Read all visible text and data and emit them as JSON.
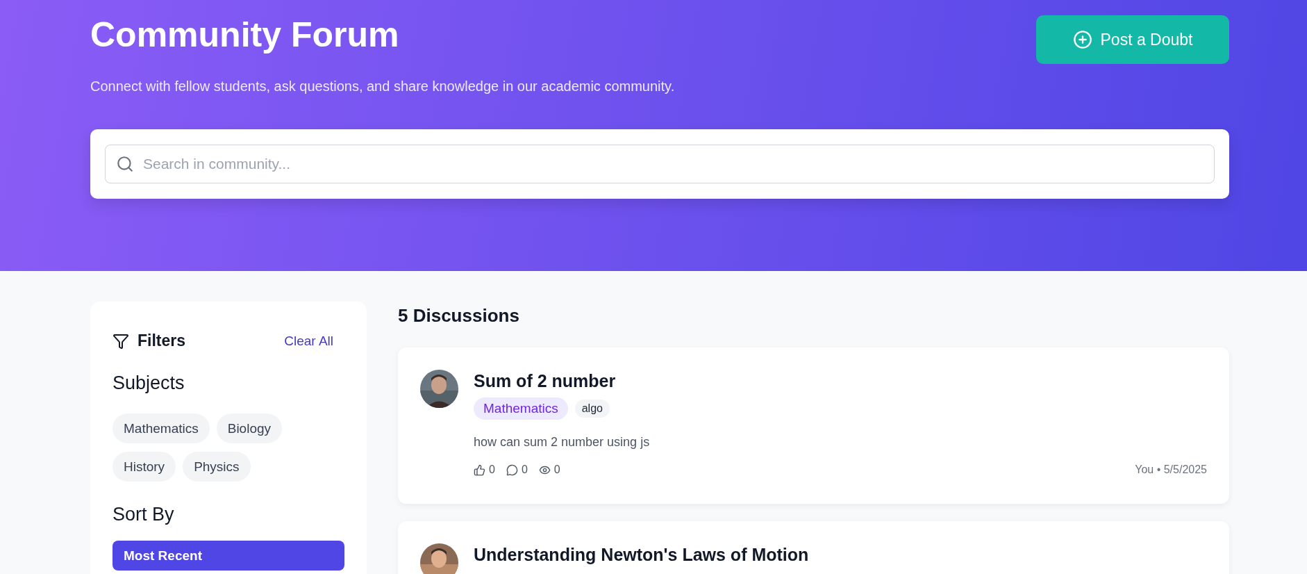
{
  "header": {
    "title": "Community Forum",
    "subtitle": "Connect with fellow students, ask questions, and share knowledge in our academic community.",
    "post_button": "Post a Doubt",
    "search": {
      "placeholder": "Search in community..."
    }
  },
  "filters": {
    "title": "Filters",
    "clear": "Clear All",
    "subjects_title": "Subjects",
    "subjects": [
      {
        "label": "Mathematics",
        "selected": false
      },
      {
        "label": "Biology",
        "selected": false
      },
      {
        "label": "History",
        "selected": false
      },
      {
        "label": "Physics",
        "selected": false
      }
    ],
    "sort_title": "Sort By",
    "sort_options": [
      {
        "label": "Most Recent",
        "selected": true
      }
    ]
  },
  "discussions": {
    "count": "5 Discussions",
    "posts": [
      {
        "title": "Sum of 2 number",
        "tags": [
          {
            "label": "Mathematics",
            "kind": "subject"
          },
          {
            "label": "algo",
            "kind": "tag"
          }
        ],
        "body": "how can sum 2 number using js",
        "likes": "0",
        "comments": "0",
        "views": "0",
        "meta": "You • 5/5/2025"
      },
      {
        "title": "Understanding Newton's Laws of Motion"
      }
    ]
  }
}
